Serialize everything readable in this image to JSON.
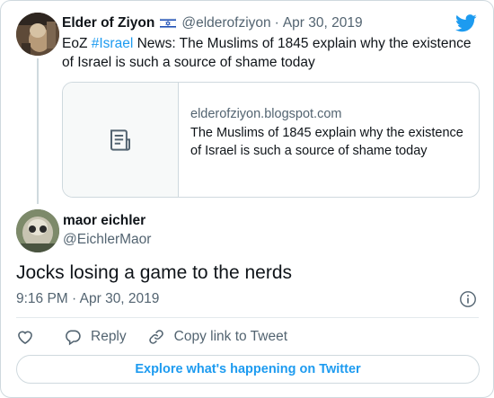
{
  "parent_tweet": {
    "author_name": "Elder of Ziyon",
    "author_handle": "@elderofziyon",
    "separator": "·",
    "date": "Apr 30, 2019",
    "text_prefix": "EoZ ",
    "hashtag": "#Israel",
    "text_suffix": " News: The Muslims of 1845 explain why the existence of Israel is such a source of shame today",
    "link_card": {
      "domain": "elderofziyon.blogspot.com",
      "title": "The Muslims of 1845 explain why the existence of Israel is such a source of shame today",
      "icon": "article-icon"
    },
    "flag_icon": "israel-flag-icon"
  },
  "main_tweet": {
    "author_name": "maor eichler",
    "author_handle": "@EichlerMaor",
    "text": "Jocks losing a game to the nerds",
    "timestamp": "9:16 PM · Apr 30, 2019"
  },
  "actions": {
    "like_icon": "heart-icon",
    "reply_label": "Reply",
    "copy_label": "Copy link to Tweet"
  },
  "explore_label": "Explore what's happening on Twitter",
  "colors": {
    "accent": "#1d9bf0",
    "text_primary": "#0f1419",
    "text_secondary": "#536471",
    "border": "#cfd9de"
  }
}
